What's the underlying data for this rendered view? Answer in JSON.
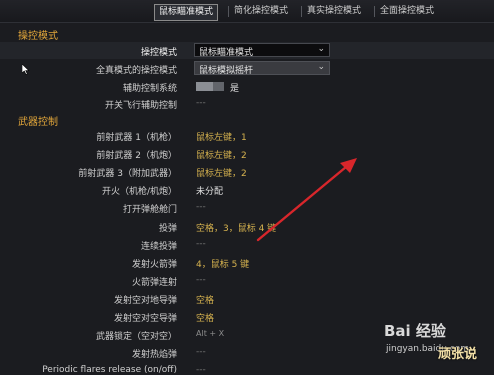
{
  "tabs": [
    {
      "label": "鼠标瞄准模式",
      "active": true
    },
    {
      "label": "简化操控模式",
      "active": false
    },
    {
      "label": "真实操控模式",
      "active": false
    },
    {
      "label": "全面操控模式",
      "active": false
    }
  ],
  "sections": {
    "control_mode": "操控模式",
    "weapon_control": "武器控制"
  },
  "control_rows": {
    "mode": {
      "label": "操控模式",
      "value": "鼠标瞄准模式"
    },
    "full_real_mode": {
      "label": "全真模式的操控模式",
      "value": "鼠标模拟摇杆"
    },
    "assist_system": {
      "label": "辅助控制系统",
      "value": "是",
      "level": 0.6
    },
    "flight_assist": {
      "label": "开关飞行辅助控制",
      "value": "---"
    }
  },
  "weapon_rows": [
    {
      "label": "前射武器 1（机枪）",
      "value": "鼠标左键，1",
      "style": "yellow"
    },
    {
      "label": "前射武器 2（机炮）",
      "value": "鼠标左键，2",
      "style": "yellow"
    },
    {
      "label": "前射武器 3（附加武器）",
      "value": "鼠标左键，2",
      "style": "yellow"
    },
    {
      "label": "开火（机枪/机炮）",
      "value": "未分配",
      "style": "white"
    },
    {
      "label": "打开弹舱舱门",
      "value": "---",
      "style": "dash"
    },
    {
      "label": "投弹",
      "value": "空格，3，鼠标 4 键",
      "style": "yellow"
    },
    {
      "label": "连续投弹",
      "value": "---",
      "style": "dash"
    },
    {
      "label": "发射火箭弹",
      "value": "4，鼠标 5 键",
      "style": "yellow"
    },
    {
      "label": "火箭弹连射",
      "value": "---",
      "style": "dash"
    },
    {
      "label": "发射空对地导弹",
      "value": "空格",
      "style": "yellow"
    },
    {
      "label": "发射空对空导弹",
      "value": "空格",
      "style": "yellow"
    },
    {
      "label": "武器锁定（空对空）",
      "value": "Alt + X",
      "style": "small"
    },
    {
      "label": "发射热焰弹",
      "value": "---",
      "style": "dash"
    },
    {
      "label": "Periodic flares release (on/off)",
      "value": "---",
      "style": "dash"
    }
  ],
  "watermark": {
    "logo": "Bai 经验",
    "url": "jingyan.baidu.com",
    "tag": "顽张说"
  },
  "colors": {
    "section": "#e2a63a",
    "binding": "#d7b34f",
    "arrow": "#d8262b"
  }
}
